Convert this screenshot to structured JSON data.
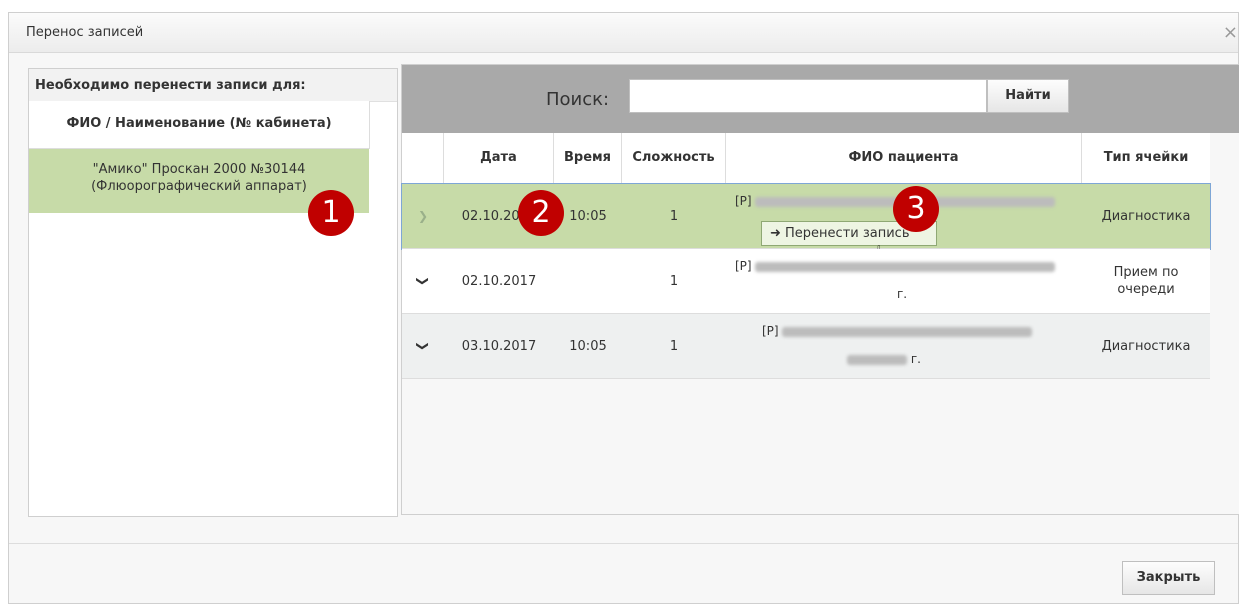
{
  "dialog": {
    "title": "Перенос записей",
    "close_glyph": "×"
  },
  "left_panel": {
    "header": "Необходимо перенести записи для:",
    "column_header": "ФИО / Наименование (№ кабинета)",
    "item_line1": "\"Амико\" Проскан 2000 №30144",
    "item_line2": "(Флюорографический аппарат)"
  },
  "search": {
    "label": "Поиск:",
    "value": "",
    "button": "Найти"
  },
  "table": {
    "headers": [
      "Дата",
      "Время",
      "Сложность",
      "ФИО пациента",
      "Тип ячейки"
    ],
    "rows": [
      {
        "date": "02.10.2017",
        "time": "10:05",
        "complexity": "1",
        "patient_prefix": "[P]",
        "patient_suffix": "",
        "type": "Диагностика"
      },
      {
        "date": "02.10.2017",
        "time": "",
        "complexity": "1",
        "patient_prefix": "[P]",
        "patient_suffix": "г.",
        "type": "Прием по очереди"
      },
      {
        "date": "03.10.2017",
        "time": "10:05",
        "complexity": "1",
        "patient_prefix": "[P]",
        "patient_suffix": "г.",
        "type": "Диагностика"
      }
    ],
    "move_button": "➜ Перенести запись"
  },
  "badges": [
    "1",
    "2",
    "3"
  ],
  "footer": {
    "close_button": "Закрыть"
  },
  "colors": {
    "selected_row": "#c7dba8",
    "badge": "#c00000",
    "search_bar": "#a9a9a9"
  },
  "icons": {
    "expand": "chevron-down-icon",
    "cursor": "hand-cursor-icon"
  }
}
